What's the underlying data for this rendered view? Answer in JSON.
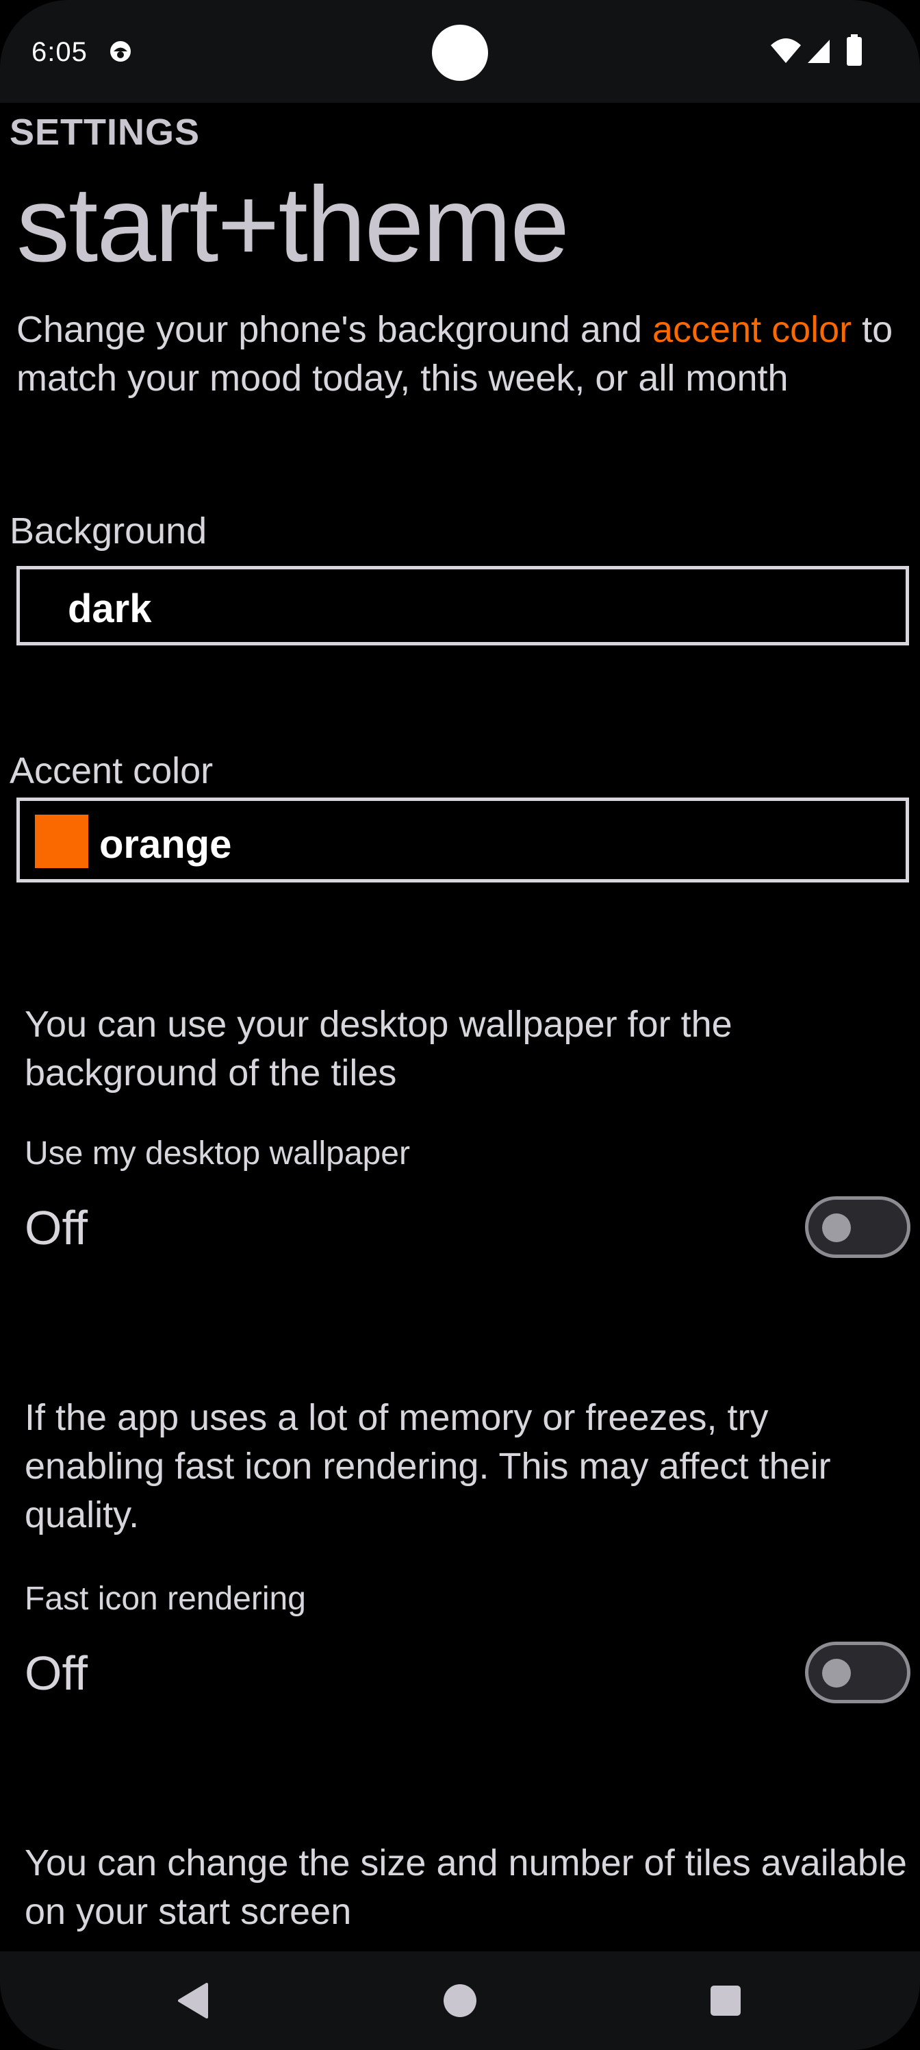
{
  "status_bar": {
    "time": "6:05",
    "icons": [
      "app-notification-icon",
      "wifi-icon",
      "cell-signal-icon",
      "battery-icon"
    ]
  },
  "header": {
    "section_label": "SETTINGS",
    "title": "start+theme"
  },
  "description": {
    "part1": "Change your phone's background and ",
    "accent_phrase": "accent color",
    "part2": " to match your mood today, this week, or all month"
  },
  "background": {
    "label": "Background",
    "value": "dark"
  },
  "accent": {
    "label": "Accent color",
    "value": "orange",
    "swatch_color": "#fa6800"
  },
  "wallpaper": {
    "info": "You can use your desktop wallpaper for the background of the tiles",
    "label": "Use my desktop wallpaper",
    "state": "Off",
    "enabled": false
  },
  "fast_icons": {
    "info": "If the app uses a lot of memory or freezes, try enabling fast icon rendering. This may affect their quality.",
    "label": "Fast icon rendering",
    "state": "Off",
    "enabled": false
  },
  "tiles": {
    "info": "You can change the size and number of tiles available on your start screen"
  },
  "nav": {
    "buttons": [
      "back-icon",
      "home-icon",
      "recents-icon"
    ]
  },
  "colors": {
    "accent": "#fa6800",
    "background": "#000000",
    "text": "#d8d6dc"
  }
}
